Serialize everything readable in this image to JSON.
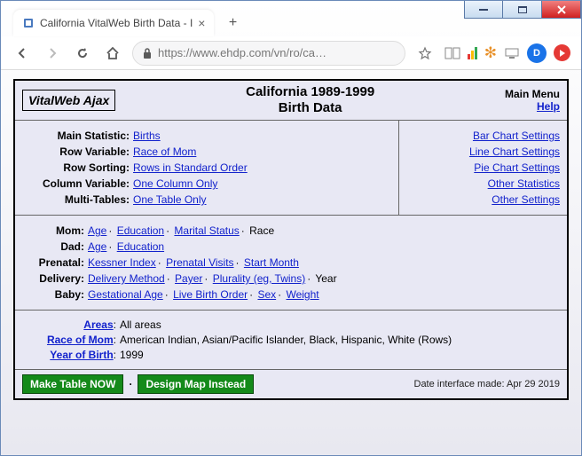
{
  "browser": {
    "tab_title": "California VitalWeb Birth Data - I",
    "url_display": "https://www.ehdp.com/vn/ro/ca…",
    "profile_letter": "D"
  },
  "header": {
    "brand": "VitalWeb Ajax",
    "title_line1": "California 1989-1999",
    "title_line2": "Birth Data",
    "menu_label": "Main Menu",
    "help_label": "Help"
  },
  "config_left": {
    "main_stat_label": "Main Statistic:",
    "main_stat_link": "Births",
    "row_var_label": "Row Variable:",
    "row_var_link": "Race of Mom",
    "row_sort_label": "Row Sorting:",
    "row_sort_link": "Rows in Standard Order",
    "col_var_label": "Column Variable:",
    "col_var_link": "One Column Only",
    "multi_label": "Multi-Tables:",
    "multi_link": "One Table Only"
  },
  "config_right": {
    "bar": "Bar Chart Settings",
    "line": "Line Chart Settings",
    "pie": "Pie Chart Settings",
    "stats": "Other Statistics",
    "other": "Other Settings"
  },
  "cats": {
    "mom_label": "Mom:",
    "mom_age": "Age",
    "mom_edu": "Education",
    "mom_mar": "Marital Status",
    "mom_race": "Race",
    "dad_label": "Dad:",
    "dad_age": "Age",
    "dad_edu": "Education",
    "pre_label": "Prenatal:",
    "pre_kess": "Kessner Index",
    "pre_visits": "Prenatal Visits",
    "pre_start": "Start Month",
    "del_label": "Delivery:",
    "del_method": "Delivery Method",
    "del_payer": "Payer",
    "del_plural": "Plurality (eg, Twins)",
    "del_year": "Year",
    "baby_label": "Baby:",
    "baby_ga": "Gestational Age",
    "baby_order": "Live Birth Order",
    "baby_sex": "Sex",
    "baby_wt": "Weight"
  },
  "sels": {
    "areas_label": "Areas",
    "areas_val": "All areas",
    "race_label": "Race of Mom",
    "race_val": "American Indian, Asian/Pacific Islander, Black, Hispanic, White (Rows)",
    "year_label": "Year of Birth",
    "year_val": "1999"
  },
  "footer": {
    "make_table": "Make Table NOW",
    "design_map": "Design Map Instead",
    "date_text": "Date interface made: Apr 29 2019"
  }
}
